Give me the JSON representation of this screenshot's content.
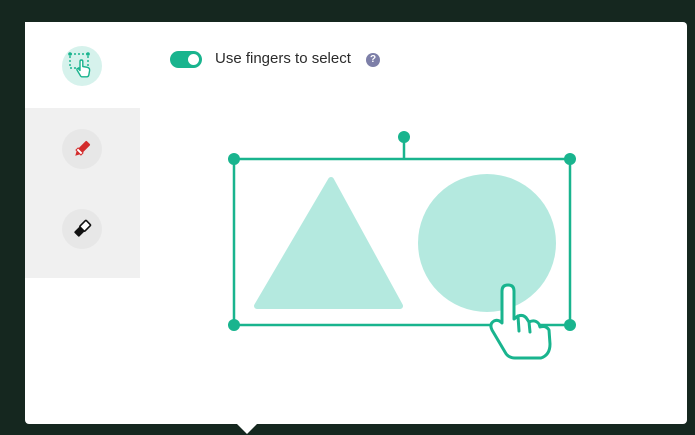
{
  "toggle": {
    "label": "Use fingers to select",
    "state": "on",
    "help_icon": "?"
  },
  "toolbar": {
    "tools": [
      {
        "name": "finger-select",
        "icon": "hand-select-icon",
        "active": true
      },
      {
        "name": "red-marker",
        "icon": "red-marker-icon",
        "active": false
      },
      {
        "name": "black-eraser",
        "icon": "eraser-icon",
        "active": false
      }
    ]
  },
  "colors": {
    "frame": "#15271f",
    "accent": "#19b48e",
    "shape_fill": "#b4e9df",
    "red_marker": "#d32c2c",
    "help": "#7d7fa8"
  }
}
